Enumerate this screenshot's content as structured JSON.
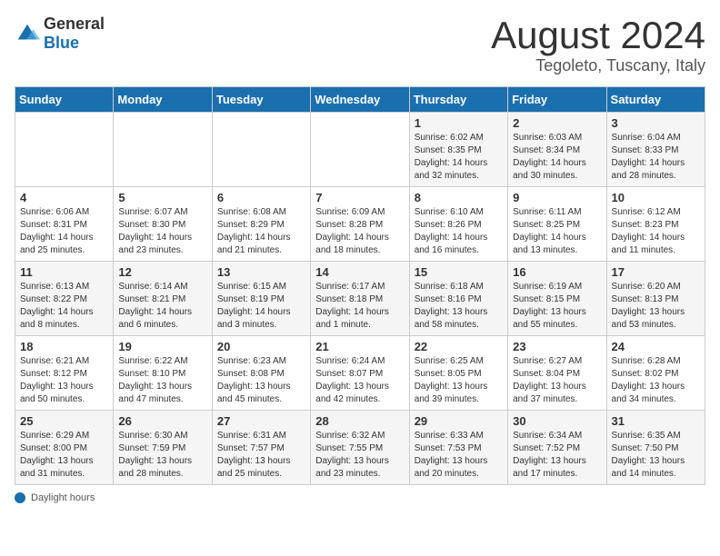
{
  "logo": {
    "general": "General",
    "blue": "Blue"
  },
  "title": "August 2024",
  "subtitle": "Tegoleto, Tuscany, Italy",
  "days_of_week": [
    "Sunday",
    "Monday",
    "Tuesday",
    "Wednesday",
    "Thursday",
    "Friday",
    "Saturday"
  ],
  "footer_label": "Daylight hours",
  "weeks": [
    [
      {
        "day": "",
        "info": ""
      },
      {
        "day": "",
        "info": ""
      },
      {
        "day": "",
        "info": ""
      },
      {
        "day": "",
        "info": ""
      },
      {
        "day": "1",
        "info": "Sunrise: 6:02 AM\nSunset: 8:35 PM\nDaylight: 14 hours and 32 minutes."
      },
      {
        "day": "2",
        "info": "Sunrise: 6:03 AM\nSunset: 8:34 PM\nDaylight: 14 hours and 30 minutes."
      },
      {
        "day": "3",
        "info": "Sunrise: 6:04 AM\nSunset: 8:33 PM\nDaylight: 14 hours and 28 minutes."
      }
    ],
    [
      {
        "day": "4",
        "info": "Sunrise: 6:06 AM\nSunset: 8:31 PM\nDaylight: 14 hours and 25 minutes."
      },
      {
        "day": "5",
        "info": "Sunrise: 6:07 AM\nSunset: 8:30 PM\nDaylight: 14 hours and 23 minutes."
      },
      {
        "day": "6",
        "info": "Sunrise: 6:08 AM\nSunset: 8:29 PM\nDaylight: 14 hours and 21 minutes."
      },
      {
        "day": "7",
        "info": "Sunrise: 6:09 AM\nSunset: 8:28 PM\nDaylight: 14 hours and 18 minutes."
      },
      {
        "day": "8",
        "info": "Sunrise: 6:10 AM\nSunset: 8:26 PM\nDaylight: 14 hours and 16 minutes."
      },
      {
        "day": "9",
        "info": "Sunrise: 6:11 AM\nSunset: 8:25 PM\nDaylight: 14 hours and 13 minutes."
      },
      {
        "day": "10",
        "info": "Sunrise: 6:12 AM\nSunset: 8:23 PM\nDaylight: 14 hours and 11 minutes."
      }
    ],
    [
      {
        "day": "11",
        "info": "Sunrise: 6:13 AM\nSunset: 8:22 PM\nDaylight: 14 hours and 8 minutes."
      },
      {
        "day": "12",
        "info": "Sunrise: 6:14 AM\nSunset: 8:21 PM\nDaylight: 14 hours and 6 minutes."
      },
      {
        "day": "13",
        "info": "Sunrise: 6:15 AM\nSunset: 8:19 PM\nDaylight: 14 hours and 3 minutes."
      },
      {
        "day": "14",
        "info": "Sunrise: 6:17 AM\nSunset: 8:18 PM\nDaylight: 14 hours and 1 minute."
      },
      {
        "day": "15",
        "info": "Sunrise: 6:18 AM\nSunset: 8:16 PM\nDaylight: 13 hours and 58 minutes."
      },
      {
        "day": "16",
        "info": "Sunrise: 6:19 AM\nSunset: 8:15 PM\nDaylight: 13 hours and 55 minutes."
      },
      {
        "day": "17",
        "info": "Sunrise: 6:20 AM\nSunset: 8:13 PM\nDaylight: 13 hours and 53 minutes."
      }
    ],
    [
      {
        "day": "18",
        "info": "Sunrise: 6:21 AM\nSunset: 8:12 PM\nDaylight: 13 hours and 50 minutes."
      },
      {
        "day": "19",
        "info": "Sunrise: 6:22 AM\nSunset: 8:10 PM\nDaylight: 13 hours and 47 minutes."
      },
      {
        "day": "20",
        "info": "Sunrise: 6:23 AM\nSunset: 8:08 PM\nDaylight: 13 hours and 45 minutes."
      },
      {
        "day": "21",
        "info": "Sunrise: 6:24 AM\nSunset: 8:07 PM\nDaylight: 13 hours and 42 minutes."
      },
      {
        "day": "22",
        "info": "Sunrise: 6:25 AM\nSunset: 8:05 PM\nDaylight: 13 hours and 39 minutes."
      },
      {
        "day": "23",
        "info": "Sunrise: 6:27 AM\nSunset: 8:04 PM\nDaylight: 13 hours and 37 minutes."
      },
      {
        "day": "24",
        "info": "Sunrise: 6:28 AM\nSunset: 8:02 PM\nDaylight: 13 hours and 34 minutes."
      }
    ],
    [
      {
        "day": "25",
        "info": "Sunrise: 6:29 AM\nSunset: 8:00 PM\nDaylight: 13 hours and 31 minutes."
      },
      {
        "day": "26",
        "info": "Sunrise: 6:30 AM\nSunset: 7:59 PM\nDaylight: 13 hours and 28 minutes."
      },
      {
        "day": "27",
        "info": "Sunrise: 6:31 AM\nSunset: 7:57 PM\nDaylight: 13 hours and 25 minutes."
      },
      {
        "day": "28",
        "info": "Sunrise: 6:32 AM\nSunset: 7:55 PM\nDaylight: 13 hours and 23 minutes."
      },
      {
        "day": "29",
        "info": "Sunrise: 6:33 AM\nSunset: 7:53 PM\nDaylight: 13 hours and 20 minutes."
      },
      {
        "day": "30",
        "info": "Sunrise: 6:34 AM\nSunset: 7:52 PM\nDaylight: 13 hours and 17 minutes."
      },
      {
        "day": "31",
        "info": "Sunrise: 6:35 AM\nSunset: 7:50 PM\nDaylight: 13 hours and 14 minutes."
      }
    ]
  ]
}
